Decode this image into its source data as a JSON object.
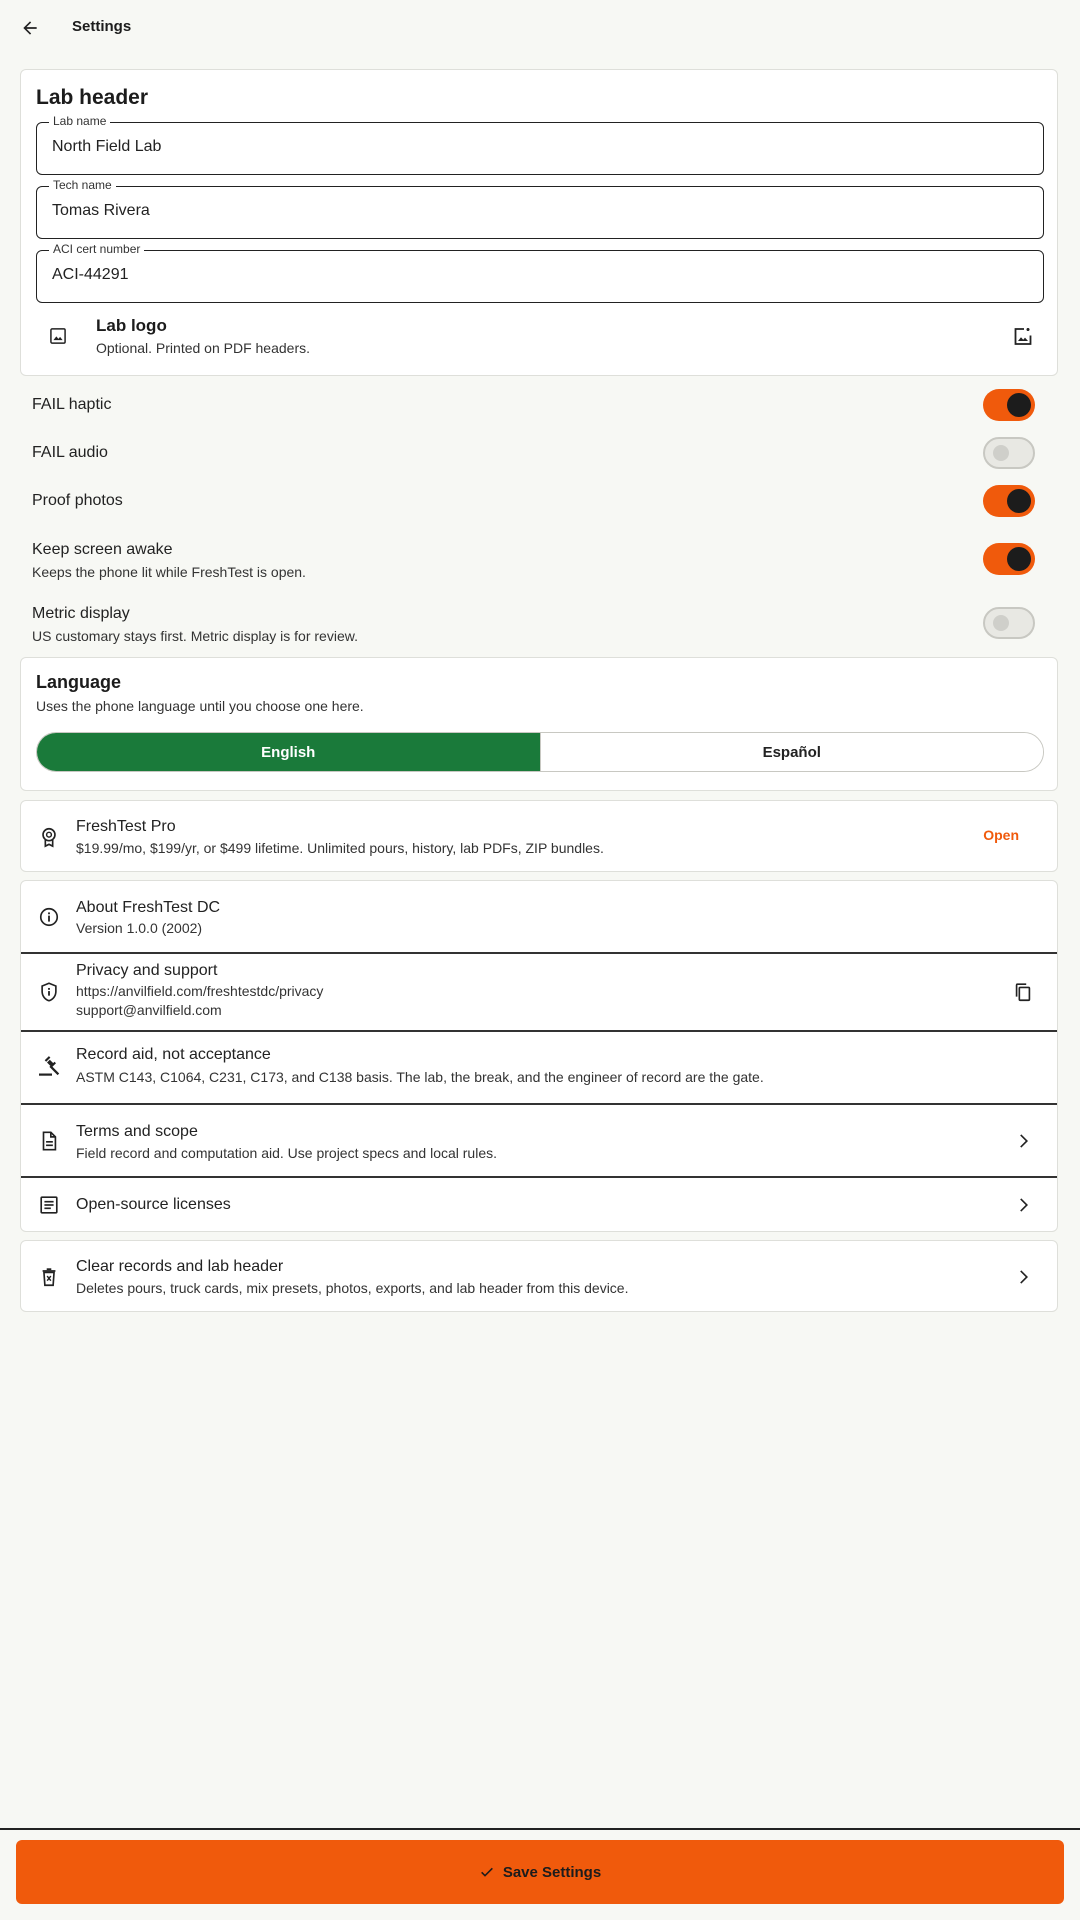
{
  "topbar": {
    "title": "Settings"
  },
  "lab_header": {
    "title": "Lab header",
    "fields": [
      {
        "label": "Lab name",
        "value": "North Field Lab"
      },
      {
        "label": "Tech name",
        "value": "Tomas Rivera"
      },
      {
        "label": "ACI cert number",
        "value": "ACI-44291"
      }
    ],
    "logo": {
      "title": "Lab logo",
      "subtitle": "Optional. Printed on PDF headers.",
      "icon": "image-icon",
      "action_icon": "add-photo-icon"
    }
  },
  "toggles": [
    {
      "label": "FAIL haptic",
      "on": true
    },
    {
      "label": "FAIL audio",
      "on": false
    },
    {
      "label": "Proof photos",
      "on": true
    },
    {
      "label": "Keep screen awake",
      "subtitle": "Keeps the phone lit while FreshTest is open.",
      "on": true
    },
    {
      "label": "Metric display",
      "subtitle": "US customary stays first. Metric display is for review.",
      "on": false
    }
  ],
  "language": {
    "title": "Language",
    "subtitle": "Uses the phone language until you choose one here.",
    "options": [
      "English",
      "Español"
    ],
    "selected": "English"
  },
  "pro": {
    "title": "FreshTest Pro",
    "subtitle": "$19.99/mo, $199/yr, or $499 lifetime. Unlimited pours, history, lab PDFs, ZIP bundles.",
    "action": "Open",
    "icon": "badge-icon"
  },
  "about_list": [
    {
      "title": "About FreshTest DC",
      "subtitle": "Version 1.0.0 (2002)",
      "icon": "info-icon"
    },
    {
      "title": "Privacy and support",
      "subtitle": "https://anvilfield.com/freshtestdc/privacy",
      "subtitle2": "support@anvilfield.com",
      "icon": "shield-icon",
      "action_icon": "copy-icon"
    },
    {
      "title": "Record aid, not acceptance",
      "subtitle": "ASTM C143, C1064, C231, C173, and C138 basis. The lab, the break, and the engineer of record are the gate.",
      "icon": "gavel-icon"
    },
    {
      "title": "Terms and scope",
      "subtitle": "Field record and computation aid. Use project specs and local rules.",
      "icon": "document-icon",
      "action_icon": "chevron-right-icon"
    },
    {
      "title": "Open-source licenses",
      "icon": "list-icon",
      "action_icon": "chevron-right-icon"
    }
  ],
  "clear": {
    "title": "Clear records and lab header",
    "subtitle": "Deletes pours, truck cards, mix presets, photos, exports, and lab header from this device.",
    "icon": "delete-icon",
    "action_icon": "chevron-right-icon"
  },
  "save": {
    "label": "Save Settings",
    "icon": "check-icon"
  },
  "colors": {
    "accent": "#f05a0c",
    "selected_language": "#1a7a3a",
    "background": "#f7f8f4"
  }
}
